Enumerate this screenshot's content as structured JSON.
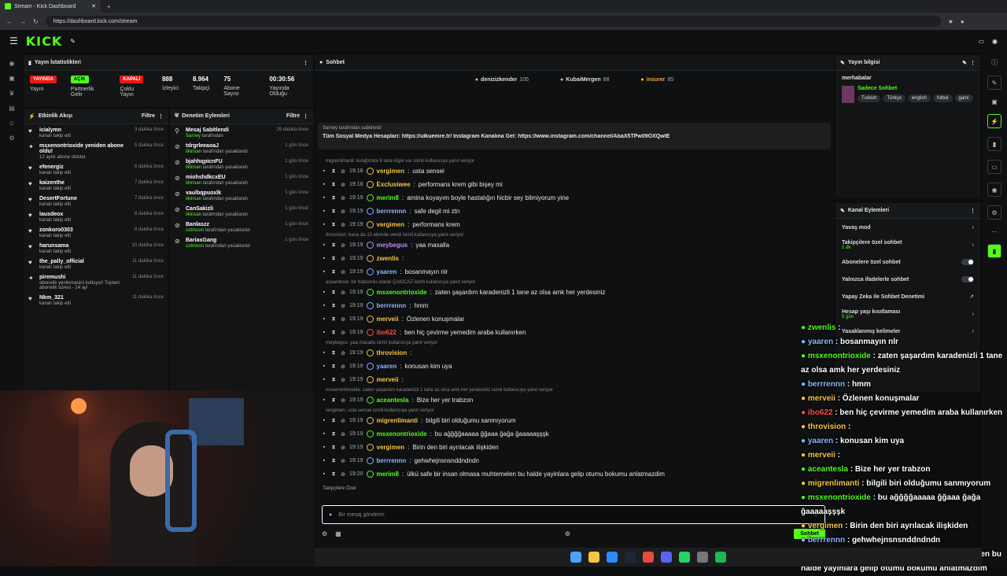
{
  "browser": {
    "tab_title": "Stream - Kick Dashboard",
    "url": "https://dashboard.kick.com/stream"
  },
  "nav": {
    "logo": "KICK"
  },
  "stats": {
    "title": "Yayın İstatistikleri",
    "items": [
      {
        "pill": "YAYINDA",
        "pill_color": "#e91916",
        "label": "Yayın"
      },
      {
        "pill": "AÇIK",
        "pill_color": "#53fc18",
        "label": "Partnerlik Gelir"
      },
      {
        "pill": "KAPALI",
        "pill_color": "#e91916",
        "label": "Çoklu Yayın"
      },
      {
        "value": "888",
        "label": "İzleyici"
      },
      {
        "value": "8.964",
        "label": "Takipçi"
      },
      {
        "value": "75",
        "label": "Abone Sayısı"
      },
      {
        "value": "00:30:56",
        "label": "Yayında Olduğu"
      }
    ]
  },
  "activity": {
    "title": "Etkinlik Akışı",
    "filter": "Filtre",
    "items": [
      {
        "name": "icialymn",
        "sub": "kanalı takip etti",
        "time": "3 dakika önce",
        "icon": "heart"
      },
      {
        "name": "msxenontrioxide yeniden abone oldu!",
        "sub": "12 aylık abone oldular",
        "time": "5 dakika önce",
        "icon": "star"
      },
      {
        "name": "efenergiz",
        "sub": "kanalı takip etti",
        "time": "6 dakika önce",
        "icon": "heart"
      },
      {
        "name": "kaizenthe",
        "sub": "kanalı takip etti",
        "time": "7 dakika önce",
        "icon": "heart"
      },
      {
        "name": "DesertFortune",
        "sub": "kanalı takip etti",
        "time": "7 dakika önce",
        "icon": "heart"
      },
      {
        "name": "lausdeox",
        "sub": "kanalı takip etti",
        "time": "8 dakika önce",
        "icon": "heart"
      },
      {
        "name": "zonkoro0303",
        "sub": "kanalı takip etti",
        "time": "8 dakika önce",
        "icon": "heart"
      },
      {
        "name": "harunsama",
        "sub": "kanalı takip etti",
        "time": "10 dakika önce",
        "icon": "heart"
      },
      {
        "name": "the_pally_official",
        "sub": "kanalı takip etti",
        "time": "11 dakika önce",
        "icon": "heart"
      },
      {
        "name": "piremushi",
        "sub": "abonelik yenilemesini kutluyor! Toplam abonelik süresi - 14 ay!",
        "time": "11 dakika önce",
        "icon": "star"
      },
      {
        "name": "Nkm_321",
        "sub": "kanalı takip etti",
        "time": "11 dakika önce",
        "icon": "heart"
      }
    ]
  },
  "mod": {
    "title": "Denetim Eylemleri",
    "filter": "Filtre",
    "items": [
      {
        "name": "Mesaj Sabitlendi",
        "by": "Sarney",
        "sub": "tarafından",
        "time": "29 dakika önce",
        "icon": "pin"
      },
      {
        "name": "tdrgrleeaoaJ",
        "by": "ilkinsan",
        "sub": "tarafından yasaklandı",
        "time": "1 gün önce",
        "icon": "ban"
      },
      {
        "name": "bjahhqpicnFU",
        "by": "ilkinsan",
        "sub": "tarafından yasaklandı",
        "time": "1 gün önce",
        "icon": "ban"
      },
      {
        "name": "miohshdkcxEU",
        "by": "ilkinsan",
        "sub": "tarafından yasaklandı",
        "time": "1 gün önce",
        "icon": "ban"
      },
      {
        "name": "vaulbqpuoxlk",
        "by": "ilkinsan",
        "sub": "tarafından yasaklandı",
        "time": "1 gün önce",
        "icon": "ban"
      },
      {
        "name": "CanSakizli",
        "by": "ilkinsan",
        "sub": "tarafından yasaklandı",
        "time": "1 gün önce",
        "icon": "ban"
      },
      {
        "name": "Banlaszz",
        "by": "cotmoon",
        "sub": "tarafından yasaklandı",
        "time": "1 gün önce",
        "icon": "ban"
      },
      {
        "name": "BariasGang",
        "by": "cotmoon",
        "sub": "tarafından yasaklandı",
        "time": "1 gün önce",
        "icon": "ban"
      }
    ]
  },
  "chat": {
    "title": "Sohbet",
    "leaders": [
      {
        "name": "denizizkender",
        "count": "105"
      },
      {
        "name": "KubaiMergen",
        "count": "88"
      },
      {
        "name": "insurer",
        "count": "85"
      }
    ],
    "pinned_by": "Sarney tarafından sabitlendi",
    "pinned_text": "Tüm Sosyal Medya Hesapları: https://ulkuemre.tr/ Instagram Kanalına Gel: https://www.instagram.com/channel/AbaX5TPw09OXQwIE",
    "messages": [
      {
        "reply": "migrenlimanti: kulağımda 6 tane küpe var isimli kullanıcıya yanıt veriyor"
      },
      {
        "time": "19:18",
        "user": "vergimen",
        "color": "#f5c542",
        "text": "usta sensei"
      },
      {
        "time": "19:18",
        "user": "Exclusiwee",
        "color": "#f5c542",
        "text": "performans krem gibi bişey mi"
      },
      {
        "time": "19:19",
        "user": "merim8",
        "color": "#53fc18",
        "text": "amina koyayım boyle hastalığın hicbir sey bilmiyorum yine"
      },
      {
        "time": "19:19",
        "user": "berrrennn",
        "color": "#8ab4ff",
        "text": "safe degil mi ztn"
      },
      {
        "time": "19:19",
        "user": "vergimen",
        "color": "#f5c542",
        "text": "performans krem"
      },
      {
        "reply": "throvision: bana da 10 ekimde vendi isimli kullanıcıya yanıt veriyor"
      },
      {
        "time": "19:19",
        "user": "meybegus",
        "color": "#c58aff",
        "text": "yaa masalla"
      },
      {
        "time": "19:19",
        "user": "zwenlis",
        "color": "#f5c542",
        "text": ""
      },
      {
        "time": "19:19",
        "user": "yaaren",
        "color": "#8ab4ff",
        "text": "bosanmayın nlr"
      },
      {
        "reply": "aceantesla: bir trabzonlu olarak ÇAKICAZ isimli kullanıcıya yanıt veriyor"
      },
      {
        "time": "19:19",
        "user": "msxenontrioxide",
        "color": "#53fc18",
        "text": "zaten şaşardım karadenizli 1 tane az olsa amk her yerdesiniz"
      },
      {
        "time": "19:19",
        "user": "berrrennn",
        "color": "#8ab4ff",
        "text": "hmm"
      },
      {
        "time": "19:19",
        "user": "merveii",
        "color": "#f5c542",
        "text": "Özlenen konuşmalar"
      },
      {
        "time": "19:19",
        "user": "ibo622",
        "color": "#ff4d4d",
        "text": "ben hiç çevirme yemedim araba kullanırken"
      },
      {
        "reply": "meybegus: yaa masalla isimli kullanıcıya yanıt veriyor"
      },
      {
        "time": "19:19",
        "user": "throvision",
        "color": "#f5c542",
        "text": ""
      },
      {
        "time": "19:19",
        "user": "yaaren",
        "color": "#8ab4ff",
        "text": "konusan kim uya"
      },
      {
        "time": "19:19",
        "user": "merveii",
        "color": "#f5c542",
        "text": ""
      },
      {
        "reply": "msxenontrioxide: zaten şaşardım karadenizli 1 tane az olsa amk her yerdesiniz isimli kullanıcıya yanıt veriyor"
      },
      {
        "time": "19:19",
        "user": "aceantesla",
        "color": "#53fc18",
        "text": "Bize her yer trabzon"
      },
      {
        "reply": "vergimen: usta sensei isimli kullanıcıya yanıt veriyor"
      },
      {
        "time": "19:19",
        "user": "migrenlimanti",
        "color": "#f5c542",
        "text": "bilgili biri olduğumu sanmıyorum"
      },
      {
        "time": "19:19",
        "user": "msxenontrioxide",
        "color": "#53fc18",
        "text": "bu ağğğğaaaaa ğğaaa ğağa ğaaaaaşşşk"
      },
      {
        "time": "19:19",
        "user": "vergimen",
        "color": "#f5c542",
        "text": "Birin den biri ayrılacak ilişkiden"
      },
      {
        "time": "19:19",
        "user": "berrrennn",
        "color": "#8ab4ff",
        "text": "gehwhejnsnsnddndndn"
      },
      {
        "time": "19:20",
        "user": "merim8",
        "color": "#53fc18",
        "text": "ülkü safe bir insan olmasa muhtemelen bu halde yayinlara gelip otumu bokumu anlatmazdim"
      }
    ],
    "followers_only": "Takipçilere Özel",
    "input_placeholder": "Bir mesaj gönderin",
    "send": "Sohbet"
  },
  "info": {
    "title": "Yayın bilgisi",
    "stream_title": "merhabalar",
    "category": "Sadece Sohbet",
    "tags": [
      "Turkish",
      "Türkçe",
      "english",
      "futbol",
      "gami"
    ]
  },
  "channel": {
    "title": "Kanal Eylemleri",
    "rows": [
      {
        "label": "Yavaş mod",
        "sub": "",
        "type": "arrow"
      },
      {
        "label": "Takipçilere özel sohbet",
        "sub": "1 dk",
        "type": "arrow"
      },
      {
        "label": "Abonelere özel sohbet",
        "sub": "",
        "type": "toggle"
      },
      {
        "label": "Yalnızca ifadelerle sohbet",
        "sub": "",
        "type": "toggle"
      },
      {
        "label": "Yapay Zeka ile Sohbet Denetimi",
        "sub": "",
        "type": "ext"
      },
      {
        "label": "Hesap yaşı kısıtlaması",
        "sub": "5 gün",
        "type": "arrow"
      },
      {
        "label": "Yasaklanmış kelimeler",
        "sub": "",
        "type": "arrow"
      }
    ]
  },
  "overlay": [
    {
      "user": "zwenlis",
      "text": "",
      "color": "#53fc18"
    },
    {
      "user": "yaaren",
      "text": "bosanmayın nlr",
      "color": "#8ab4ff"
    },
    {
      "user": "msxenontrioxide",
      "text": "zaten şaşardım karadenizli 1 tane az olsa amk her yerdesiniz",
      "color": "#53fc18"
    },
    {
      "user": "berrrennn",
      "text": "hmm",
      "color": "#8ab4ff"
    },
    {
      "user": "merveii",
      "text": "Özlenen konuşmalar",
      "color": "#f5c542"
    },
    {
      "user": "ibo622",
      "text": "ben hiç çevirme yemedim araba kullanırken",
      "color": "#ff4d4d"
    },
    {
      "user": "throvision",
      "text": "",
      "color": "#f5c542"
    },
    {
      "user": "yaaren",
      "text": "konusan kim uya",
      "color": "#8ab4ff"
    },
    {
      "user": "merveii",
      "text": "",
      "color": "#f5c542"
    },
    {
      "user": "aceantesla",
      "text": "Bize her yer trabzon",
      "color": "#53fc18"
    },
    {
      "user": "migrenlimanti",
      "text": "bilgili biri olduğumu sanmıyorum",
      "color": "#f5c542"
    },
    {
      "user": "msxenontrioxide",
      "text": "bu ağğğğaaaaa ğğaaa ğağa ğaaaaaşşşk",
      "color": "#53fc18"
    },
    {
      "user": "vergimen",
      "text": "Birin den biri ayrılacak ilişkiden",
      "color": "#f5c542"
    },
    {
      "user": "berrrennn",
      "text": "gehwhejnsnsnddndndn",
      "color": "#8ab4ff"
    },
    {
      "user": "merim8",
      "text": "ülkü safe bir insan olmasa muhtemelen bu halde yayinlara gelip otumu bokumu anlatmazdim",
      "color": "#53fc18"
    }
  ]
}
